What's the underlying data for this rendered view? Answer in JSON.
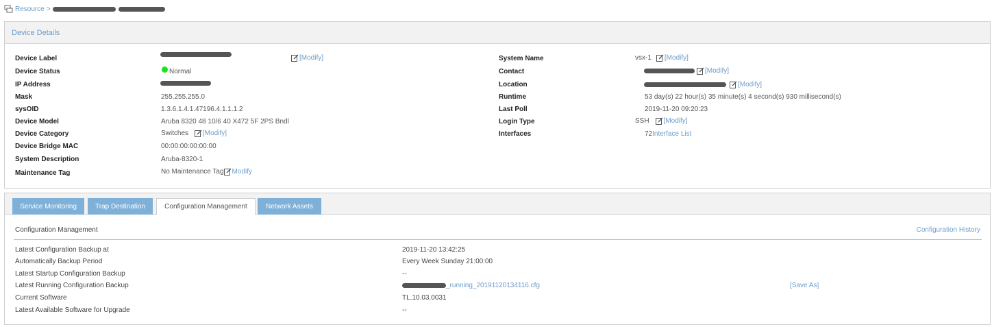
{
  "breadcrumb": {
    "root": "Resource",
    "separator": ">"
  },
  "device_details": {
    "title": "Device Details",
    "modify_label": "[Modify]",
    "modify_plain": "Modify",
    "left": [
      {
        "label": "Device Label",
        "value": ""
      },
      {
        "label": "Device Status",
        "value": "Normal"
      },
      {
        "label": "IP Address",
        "value": ""
      },
      {
        "label": "Mask",
        "value": "255.255.255.0"
      },
      {
        "label": "sysOID",
        "value": "1.3.6.1.4.1.47196.4.1.1.1.2"
      },
      {
        "label": "Device Model",
        "value": "Aruba 8320 48 10/6 40 X472 5F 2PS Bndl"
      },
      {
        "label": "Device Category",
        "value": "Switches"
      },
      {
        "label": "Device Bridge MAC",
        "value": "00:00:00:00:00:00"
      },
      {
        "label": "System Description",
        "value": "Aruba-8320-1"
      },
      {
        "label": "Maintenance Tag",
        "value": "No Maintenance Tag"
      }
    ],
    "right": [
      {
        "label": "System Name",
        "value": "vsx-1"
      },
      {
        "label": "Contact",
        "value": ""
      },
      {
        "label": "Location",
        "value": ""
      },
      {
        "label": "Runtime",
        "value": "53 day(s) 22 hour(s) 35 minute(s) 4 second(s) 930 millisecond(s)"
      },
      {
        "label": "Last Poll",
        "value": "2019-11-20 09:20:23"
      },
      {
        "label": "Login Type",
        "value": "SSH"
      },
      {
        "label": "Interfaces",
        "value": "72",
        "link": "Interface List"
      }
    ]
  },
  "tabs": [
    {
      "label": "Service Monitoring",
      "active": false
    },
    {
      "label": "Trap Destination",
      "active": false
    },
    {
      "label": "Configuration Management",
      "active": true
    },
    {
      "label": "Network Assets",
      "active": false
    }
  ],
  "config": {
    "title": "Configuration Management",
    "history_link": "Configuration History",
    "rows": [
      {
        "label": "Latest Configuration Backup at",
        "value": "2019-11-20 13:42:25"
      },
      {
        "label": "Automatically Backup Period",
        "value": "Every Week Sunday 21:00:00"
      },
      {
        "label": "Latest Startup Configuration Backup",
        "value": "--"
      },
      {
        "label": "Latest Running Configuration Backup",
        "value": "_running_20191120134116.cfg",
        "extra": "[Save As]"
      },
      {
        "label": "Current Software",
        "value": "TL.10.03.0031"
      },
      {
        "label": "Latest Available Software for Upgrade",
        "value": "--"
      }
    ]
  },
  "colors": {
    "link": "#6f9bc8",
    "tab": "#7fb0d8",
    "status_ok": "#19e619"
  }
}
